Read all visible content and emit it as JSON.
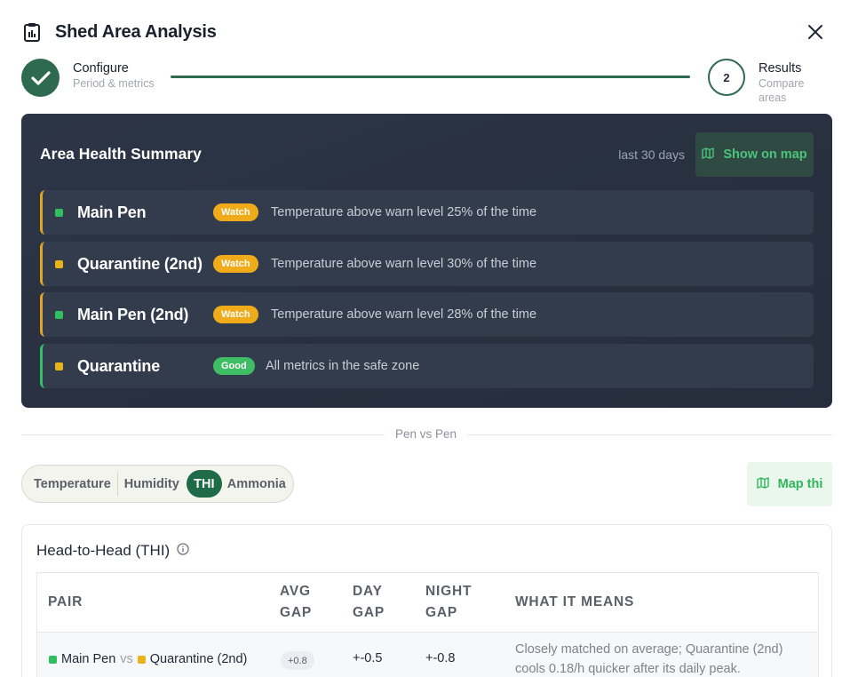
{
  "header": {
    "title": "Shed Area Analysis",
    "icon": "clipboard-chart-icon",
    "close_icon": "close-icon"
  },
  "stepper": {
    "steps": [
      {
        "title": "Configure",
        "subtitle": "Period & metrics",
        "state": "done"
      },
      {
        "number": "2",
        "title": "Results",
        "subtitle": "Compare areas",
        "state": "current"
      }
    ]
  },
  "summary": {
    "title": "Area Health Summary",
    "period": "last 30 days",
    "map_button": "Show on map",
    "rows": [
      {
        "name": "Main Pen",
        "dot_color": "#2fbf5f",
        "badge": "Watch",
        "status": "watch",
        "text": "Temperature above warn level 25% of the time"
      },
      {
        "name": "Quarantine (2nd)",
        "dot_color": "#e9b21b",
        "badge": "Watch",
        "status": "watch",
        "text": "Temperature above warn level 30% of the time"
      },
      {
        "name": "Main Pen (2nd)",
        "dot_color": "#2fbf5f",
        "badge": "Watch",
        "status": "watch",
        "text": "Temperature above warn level 28% of the time"
      },
      {
        "name": "Quarantine",
        "dot_color": "#e9b21b",
        "badge": "Good",
        "status": "good",
        "text": "All metrics in the safe zone"
      }
    ]
  },
  "divider_label": "Pen vs Pen",
  "metric_tabs": {
    "items": [
      "Temperature",
      "Humidity",
      "THI",
      "Ammonia"
    ],
    "active": "THI"
  },
  "map_thi_button": "Map thi",
  "head_to_head": {
    "title": "Head-to-Head (THI)",
    "columns": {
      "pair": "PAIR",
      "avg_gap_1": "AVG",
      "avg_gap_2": "GAP",
      "day_gap_1": "DAY",
      "day_gap_2": "GAP",
      "night_gap_1": "NIGHT",
      "night_gap_2": "GAP",
      "meaning": "WHAT IT MEANS"
    },
    "rows": [
      {
        "a": "Main Pen",
        "a_color": "#2fbf5f",
        "vs": "vs",
        "b": "Quarantine (2nd)",
        "b_color": "#e9b21b",
        "avg_gap": "+0.8",
        "day_gap": "+-0.5",
        "night_gap": "+-0.8",
        "meaning_1": "Closely matched on average; Quarantine (2nd)",
        "meaning_2": "cools 0.18/h quicker after its daily peak."
      }
    ]
  },
  "colors": {
    "brand_green": "#2d6a4f",
    "watch": "#efab19",
    "good": "#3ebd64",
    "card_dark": "#2a3242"
  }
}
